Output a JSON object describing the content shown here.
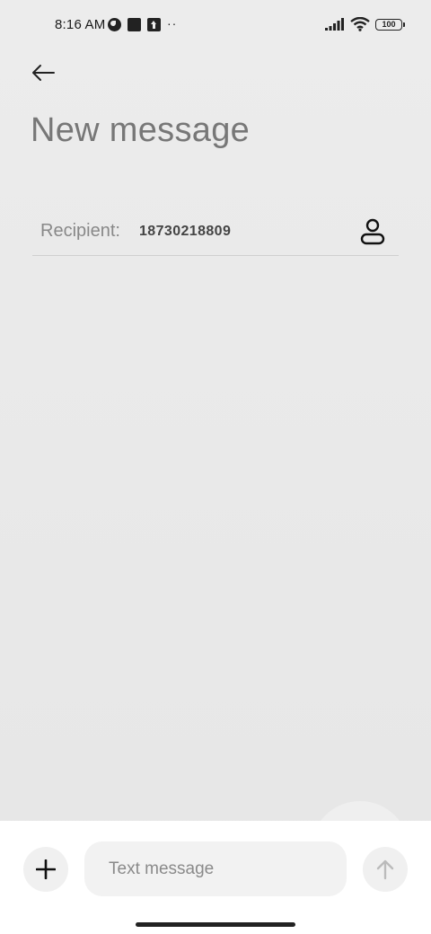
{
  "status_bar": {
    "time": "8:16 AM",
    "left_icons": [
      "data-saver-icon",
      "notification-square-icon",
      "upload-icon",
      "more-dots-icon"
    ],
    "more_dots": "··",
    "right_icons": [
      "signal-icon",
      "wifi-icon",
      "battery-icon"
    ],
    "battery_level": "100"
  },
  "header": {
    "back_icon": "arrow-left-icon",
    "title": "New message"
  },
  "recipient": {
    "label": "Recipient:",
    "value": "18730218809",
    "contact_icon": "contact-icon"
  },
  "composer": {
    "attach_icon": "plus-icon",
    "placeholder": "Text message",
    "value": "",
    "send_icon": "arrow-up-icon"
  },
  "colors": {
    "background": "#e9e9e9",
    "title": "#777777",
    "composer_bg": "#ffffff",
    "field_bg": "#f2f2f2"
  }
}
